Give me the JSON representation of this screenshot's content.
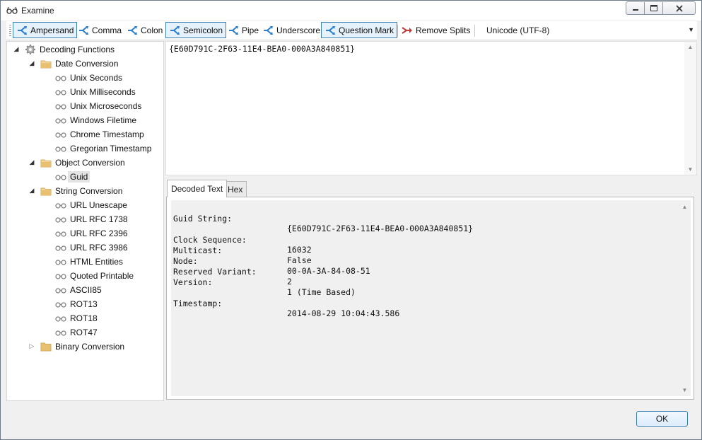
{
  "window": {
    "title": "Examine"
  },
  "toolbar": {
    "buttons": [
      {
        "label": "Ampersand",
        "active": true
      },
      {
        "label": "Comma",
        "active": false
      },
      {
        "label": "Colon",
        "active": false
      },
      {
        "label": "Semicolon",
        "active": true
      },
      {
        "label": "Pipe",
        "active": false
      },
      {
        "label": "Underscore",
        "active": false
      },
      {
        "label": "Question Mark",
        "active": true
      }
    ],
    "remove_splits_label": "Remove Splits",
    "encoding": "Unicode (UTF-8)"
  },
  "tree": {
    "root": "Decoding Functions",
    "groups": [
      {
        "label": "Date Conversion",
        "items": [
          "Unix Seconds",
          "Unix Milliseconds",
          "Unix Microseconds",
          "Windows Filetime",
          "Chrome Timestamp",
          "Gregorian Timestamp"
        ]
      },
      {
        "label": "Object Conversion",
        "items": [
          "Guid"
        ]
      },
      {
        "label": "String Conversion",
        "items": [
          "URL Unescape",
          "URL RFC 1738",
          "URL RFC 2396",
          "URL RFC 3986",
          "HTML Entities",
          "Quoted Printable",
          "ASCII85",
          "ROT13",
          "ROT18",
          "ROT47"
        ]
      },
      {
        "label": "Binary Conversion",
        "items": []
      }
    ],
    "selected": "Guid"
  },
  "input": {
    "text": "{E60D791C-2F63-11E4-BEA0-000A3A840851}"
  },
  "tabs": [
    {
      "label": "Decoded Text"
    },
    {
      "label": "Hex"
    }
  ],
  "decoded": {
    "rows": [
      {
        "key": "Guid String:",
        "value": "{E60D791C-2F63-11E4-BEA0-000A3A840851}"
      },
      {
        "key": "Clock Sequence:",
        "value": "16032"
      },
      {
        "key": "Multicast:",
        "value": "False"
      },
      {
        "key": "Node:",
        "value": "00-0A-3A-84-08-51"
      },
      {
        "key": "Reserved Variant:",
        "value": "2"
      },
      {
        "key": "Version:",
        "value": "1 (Time Based)"
      },
      {
        "key": "Timestamp:",
        "value": "2014-08-29 10:04:43.586"
      }
    ]
  },
  "footer": {
    "ok_label": "OK"
  },
  "icons": {
    "split": "split-arrow-icon",
    "remove": "remove-splits-icon",
    "folder": "folder-icon",
    "gear": "gear-icon",
    "glasses": "glasses-icon"
  },
  "colors": {
    "accent": "#3c7fb1",
    "split_icon": "#2d7fc9",
    "remove_icon": "#c43a3a",
    "folder": "#e8c072"
  }
}
